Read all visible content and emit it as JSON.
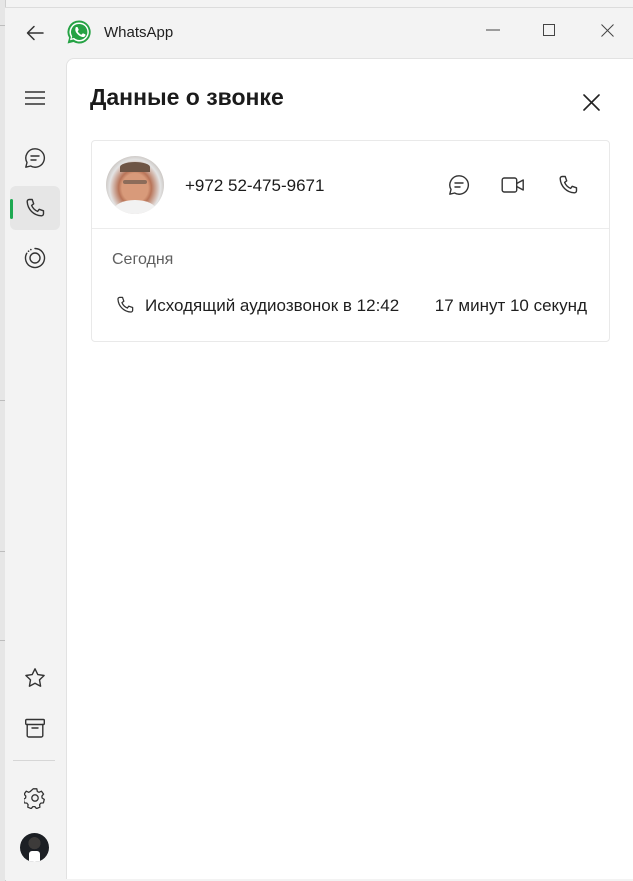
{
  "window": {
    "app_title": "WhatsApp"
  },
  "sidebar": {
    "items": [
      {
        "name": "menu",
        "icon": "hamburger-icon"
      },
      {
        "name": "chats",
        "icon": "chat-bubble-icon"
      },
      {
        "name": "calls",
        "icon": "phone-icon",
        "active": true
      },
      {
        "name": "status",
        "icon": "status-ring-icon"
      },
      {
        "name": "starred",
        "icon": "star-icon"
      },
      {
        "name": "archived",
        "icon": "archive-icon"
      },
      {
        "name": "settings",
        "icon": "gear-icon"
      },
      {
        "name": "profile",
        "icon": "avatar"
      }
    ]
  },
  "panel": {
    "title": "Данные о звонке",
    "contact": {
      "phone": "+972 52-475-9671"
    },
    "actions": [
      "chat-bubble-icon",
      "video-camera-icon",
      "phone-icon"
    ],
    "section_label": "Сегодня",
    "calls": [
      {
        "description": "Исходящий аудиозвонок в 12:42",
        "duration": "17 минут 10 секунд"
      }
    ]
  },
  "colors": {
    "accent": "#1da851",
    "window_bg": "#f3f3f3",
    "panel_bg": "#ffffff"
  }
}
